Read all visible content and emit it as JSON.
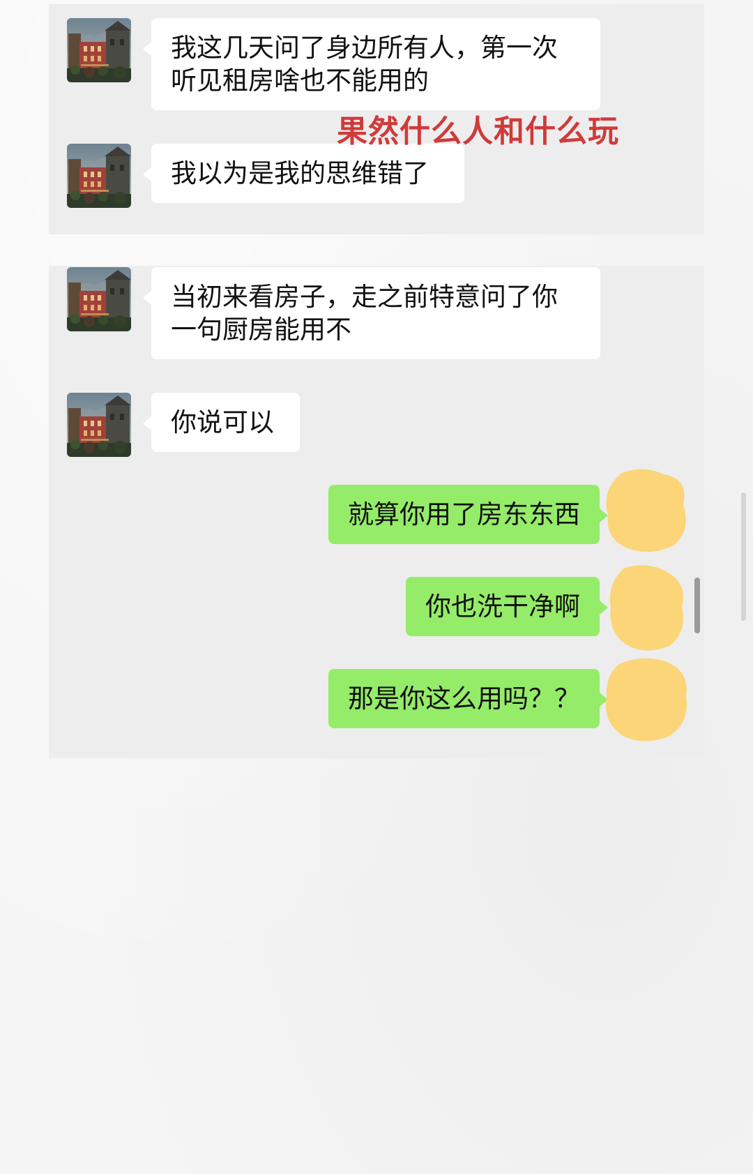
{
  "messages": [
    {
      "direction": "in",
      "lines": [
        "我这几天问了身边所有人，第一次",
        "听见租房啥也不能用的"
      ]
    },
    {
      "direction": "in",
      "lines": [
        "我以为是我的思维错了"
      ]
    },
    {
      "direction": "in",
      "lines": [
        "当初来看房子，走之前特意问了你",
        "一句厨房能用不"
      ]
    },
    {
      "direction": "in",
      "lines": [
        "你说可以"
      ]
    },
    {
      "direction": "out",
      "lines": [
        "就算你用了房东东西"
      ]
    },
    {
      "direction": "out",
      "lines": [
        "你也洗干净啊"
      ]
    },
    {
      "direction": "out",
      "lines": [
        "那是你这么用吗？？"
      ]
    }
  ],
  "annotation": "果然什么人和什么玩",
  "colors": {
    "incoming_bubble": "#ffffff",
    "outgoing_bubble": "#95ec69",
    "annotation_text": "#d03a3a",
    "panel_background": "#ededed",
    "redaction_blob": "#fcd36e"
  },
  "icons": {
    "contact_avatar": "castle-photo-avatar",
    "self_avatar": "redacted-yellow-blob"
  }
}
